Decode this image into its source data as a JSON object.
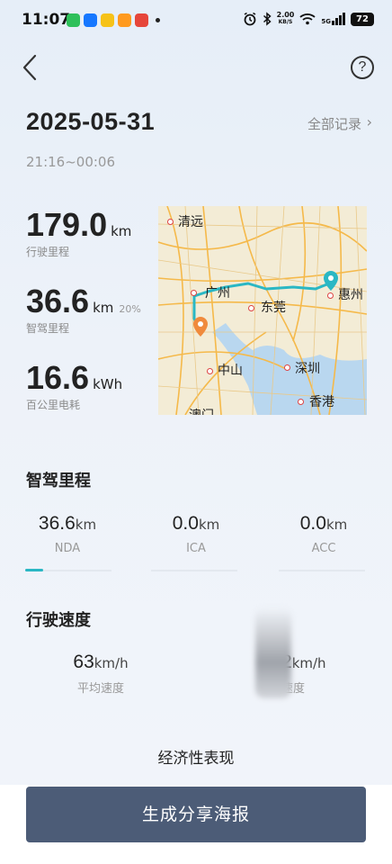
{
  "status_bar": {
    "time": "11:07",
    "net_speed_value": "2.00",
    "net_speed_unit": "KB/S",
    "signal": "5G",
    "battery": "72"
  },
  "header": {
    "back_icon": "chevron-left-icon",
    "help_label": "?"
  },
  "trip": {
    "date": "2025-05-31",
    "all_records_label": "全部记录",
    "time_range": "21:16~00:06"
  },
  "stats": [
    {
      "value": "179.0",
      "unit": "km",
      "extra": "",
      "label": "行驶里程"
    },
    {
      "value": "36.6",
      "unit": "km",
      "extra": "20%",
      "label": "智驾里程"
    },
    {
      "value": "16.6",
      "unit": "kWh",
      "extra": "",
      "label": "百公里电耗"
    }
  ],
  "map": {
    "cities": [
      "清远",
      "广州",
      "东莞",
      "惠州",
      "中山",
      "深圳",
      "香港",
      "澳门"
    ],
    "route_color": "#2ab7c4",
    "start_marker_color": "#f08a3c"
  },
  "smart_driving": {
    "title": "智驾里程",
    "metrics": [
      {
        "value": "36.6",
        "unit": "km",
        "label": "NDA"
      },
      {
        "value": "0.0",
        "unit": "km",
        "label": "ICA"
      },
      {
        "value": "0.0",
        "unit": "km",
        "label": "ACC"
      }
    ],
    "active_tab": "NDA"
  },
  "speed": {
    "title": "行驶速度",
    "avg_value": "63",
    "avg_unit": "km/h",
    "avg_label": "平均速度",
    "max_value": "2",
    "max_unit": "km/h",
    "max_label": "速度"
  },
  "economy": {
    "title": "经济性表现"
  },
  "cta": {
    "label": "生成分享海报"
  },
  "colors": {
    "accent": "#2ab7c4",
    "button": "#4c5c77"
  }
}
